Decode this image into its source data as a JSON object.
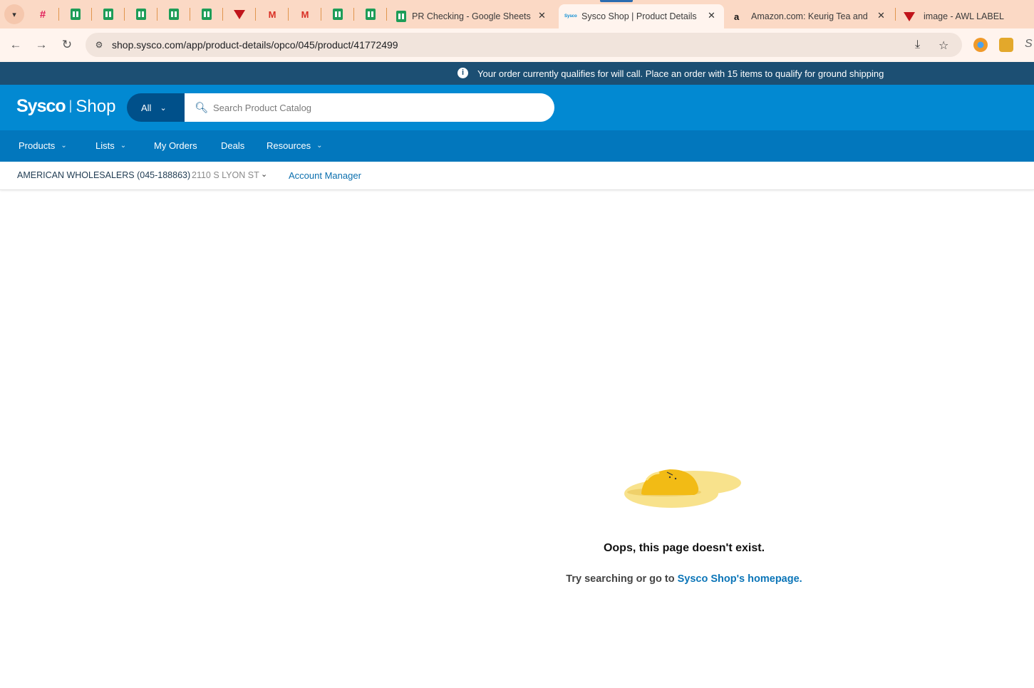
{
  "browser": {
    "tabs": [
      {
        "title": "PR Checking - Google Sheets",
        "icon": "sheets-icon"
      },
      {
        "title": "Sysco Shop | Product Details",
        "icon": "sysco-icon",
        "active": true
      },
      {
        "title": "Amazon.com: Keurig Tea and Ic",
        "icon": "amazon-icon"
      },
      {
        "title": "image - AWL LABEL",
        "icon": "awl-icon"
      }
    ],
    "url": "shop.sysco.com/app/product-details/opco/045/product/41772499",
    "sysco_favicon_text": "Sysco"
  },
  "banner": {
    "text": "Your order currently qualifies for will call. Place an order with 15 items to qualify for ground shipping"
  },
  "header": {
    "brand": "Sysco",
    "divider": "|",
    "product": "Shop",
    "search_scope": "All",
    "search_placeholder": "Search Product Catalog"
  },
  "nav": {
    "items": [
      {
        "label": "Products",
        "has_dropdown": true
      },
      {
        "label": "Lists",
        "has_dropdown": true
      },
      {
        "label": "My Orders",
        "has_dropdown": false
      },
      {
        "label": "Deals",
        "has_dropdown": false
      },
      {
        "label": "Resources",
        "has_dropdown": true
      }
    ]
  },
  "account": {
    "name": "AMERICAN WHOLESALERS (045-188863)",
    "address": "2110 S LYON ST",
    "manager_link": "Account Manager"
  },
  "error": {
    "title": "Oops, this page doesn't exist.",
    "subtitle_prefix": "Try searching or go to ",
    "homepage_link": "Sysco Shop's homepage."
  },
  "colors": {
    "banner": "#1c4f73",
    "header": "#0289d2",
    "navbar": "#0277bd",
    "link": "#0b75b8",
    "tabstrip": "#fbd9c5"
  }
}
